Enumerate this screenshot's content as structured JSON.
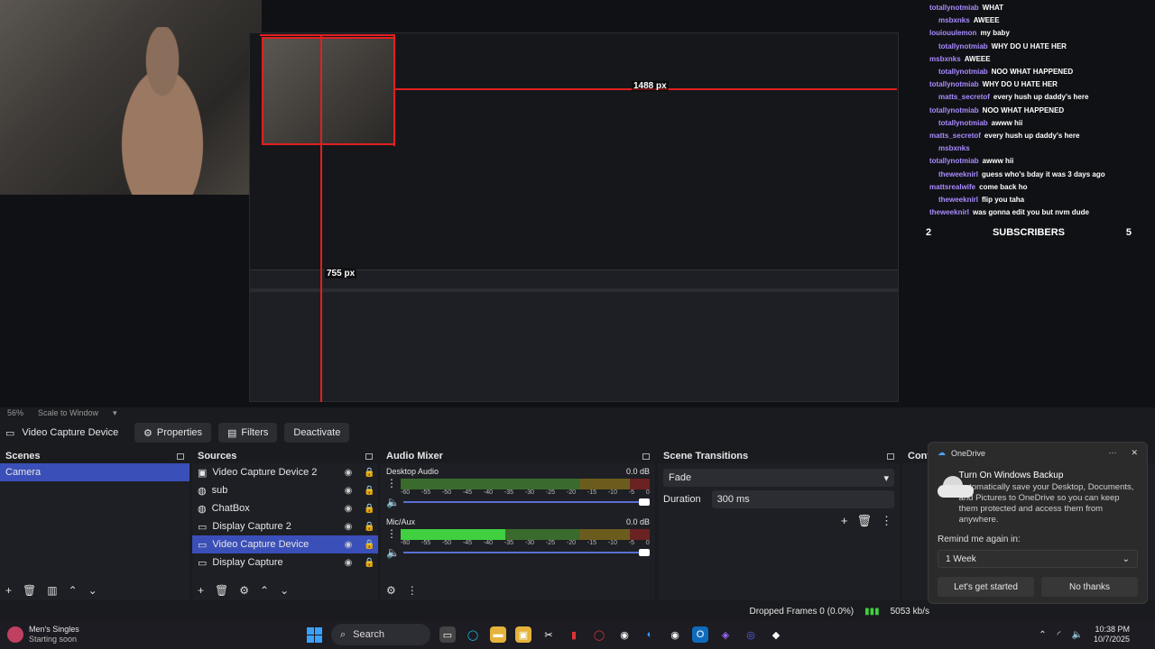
{
  "preview": {
    "px_label_top": "1488 px",
    "px_label_mid": "755 px"
  },
  "chat": {
    "lines": [
      {
        "user": "totallynotmiab",
        "msg": "WHAT"
      },
      {
        "user": "msbxnks",
        "msg": "AWEEE"
      },
      {
        "user": "louiouulemon",
        "msg": "my baby"
      },
      {
        "user": "totallynotmiab",
        "msg": "WHY DO U HATE HER"
      },
      {
        "user": "msbxnks",
        "msg": "AWEEE"
      },
      {
        "user": "totallynotmiab",
        "msg": "NOO WHAT HAPPENED"
      },
      {
        "user": "totallynotmiab",
        "msg": "WHY DO U HATE HER"
      },
      {
        "user": "matts_secretof",
        "msg": "every hush up daddy's here"
      },
      {
        "user": "totallynotmiab",
        "msg": "NOO WHAT HAPPENED"
      },
      {
        "user": "totallynotmiab",
        "msg": "awww hii"
      },
      {
        "user": "matts_secretof",
        "msg": "every hush up daddy's here"
      },
      {
        "user": "msbxnks",
        "msg": ""
      },
      {
        "user": "totallynotmiab",
        "msg": "awww hii"
      },
      {
        "user": "theweeknirl",
        "msg": "guess who's bday it was 3 days ago"
      },
      {
        "user": "mattsrealwife",
        "msg": "come back ho"
      },
      {
        "user": "theweeknirl",
        "msg": "flip you taha"
      },
      {
        "user": "theweeknirl",
        "msg": "was gonna edit you but nvm dude"
      }
    ],
    "subs_left": "2",
    "subs_label": "SUBSCRIBERS",
    "subs_right": "5"
  },
  "zoombar": {
    "zoom": "56%",
    "mode": "Scale to Window"
  },
  "toolbar": {
    "source_name": "Video Capture Device",
    "properties": "Properties",
    "filters": "Filters",
    "deactivate": "Deactivate"
  },
  "scenes": {
    "title": "Scenes",
    "items": [
      "Camera"
    ]
  },
  "sources": {
    "title": "Sources",
    "items": [
      "Video Capture Device 2",
      "sub",
      "ChatBox",
      "Display Capture 2",
      "Video Capture Device",
      "Display Capture"
    ]
  },
  "mixer": {
    "title": "Audio Mixer",
    "channels": [
      {
        "name": "Desktop Audio",
        "db": "0.0 dB",
        "level": 0
      },
      {
        "name": "Mic/Aux",
        "db": "0.0 dB",
        "level": 0.42
      }
    ],
    "ticks": [
      "-60",
      "-55",
      "-50",
      "-45",
      "-40",
      "-35",
      "-30",
      "-25",
      "-20",
      "-15",
      "-10",
      "-5",
      "0"
    ]
  },
  "transitions": {
    "title": "Scene Transitions",
    "selected": "Fade",
    "duration_label": "Duration",
    "duration_value": "300 ms"
  },
  "controls": {
    "title": "Cont"
  },
  "onedrive": {
    "app": "OneDrive",
    "title": "Turn On Windows Backup",
    "text": "Automatically save your Desktop, Documents, and Pictures to OneDrive so you can keep them protected and access them from anywhere.",
    "remind_label": "Remind me again in:",
    "remind_value": "1 Week",
    "primary": "Let's get started",
    "secondary": "No thanks"
  },
  "status": {
    "dropped": "Dropped Frames 0 (0.0%)",
    "bitrate": "5053 kb/s"
  },
  "taskbar": {
    "app_title": "Men's Singles",
    "app_sub": "Starting soon",
    "search": "Search",
    "time": "10:38 PM",
    "date": "10/7/2025"
  }
}
